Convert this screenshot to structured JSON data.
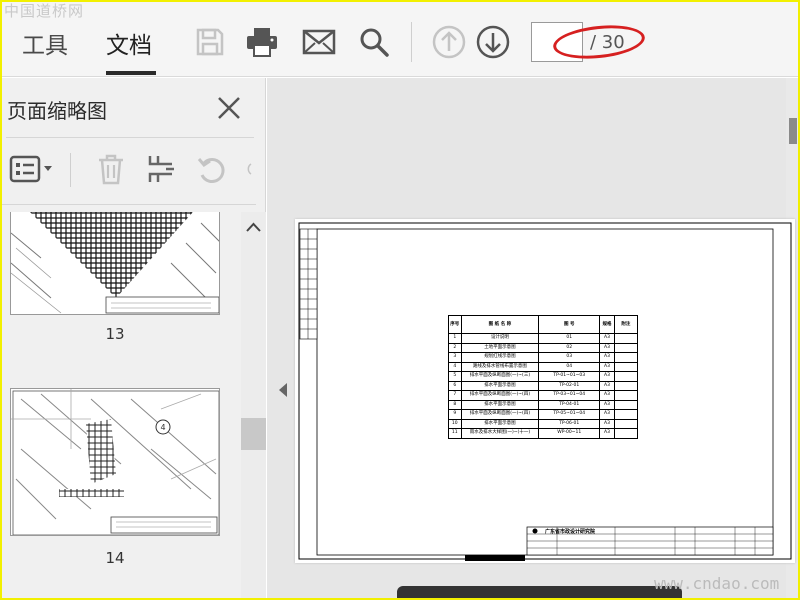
{
  "watermarks": {
    "top": "中国道桥网",
    "bottom": "www.cndao.com"
  },
  "toolbar": {
    "tabs": [
      {
        "label": "工具"
      },
      {
        "label": "文档"
      }
    ],
    "page_current": "",
    "page_total": "/ 30"
  },
  "panel": {
    "title": "页面缩略图",
    "thumbnails": [
      {
        "label": "13"
      },
      {
        "label": "14"
      }
    ]
  },
  "drawing": {
    "table_headers": [
      "序号",
      "图 纸 名 称",
      "图 号",
      "规格",
      "附注"
    ],
    "rows": [
      [
        "1",
        "设计说明",
        "01",
        "A3"
      ],
      [
        "2",
        "土地平面示意图",
        "02",
        "A3"
      ],
      [
        "3",
        "规划红线示意图",
        "03",
        "A3"
      ],
      [
        "4",
        "路线及排水管线布置示意图",
        "04",
        "A3"
      ],
      [
        "5",
        "排水平面及纵断面图(一)~(三)",
        "TP-01~01~03",
        "A3"
      ],
      [
        "6",
        "排水平面示意图",
        "TP-02-01",
        "A3"
      ],
      [
        "7",
        "排水平面及纵断面图(一)~(四)",
        "TP-03~01~04",
        "A3"
      ],
      [
        "8",
        "排水平面示意图",
        "TP-04-01",
        "A3"
      ],
      [
        "9",
        "排水平面及纵断面图(一)~(四)",
        "TP-05~01~04",
        "A3"
      ],
      [
        "10",
        "排水平面示意图",
        "TP-06-01",
        "A3"
      ],
      [
        "11",
        "雨水及排水大样图(一)~(十一)",
        "WP-00~11",
        "A3"
      ]
    ],
    "title_block": "广东省市政设计研究院"
  }
}
